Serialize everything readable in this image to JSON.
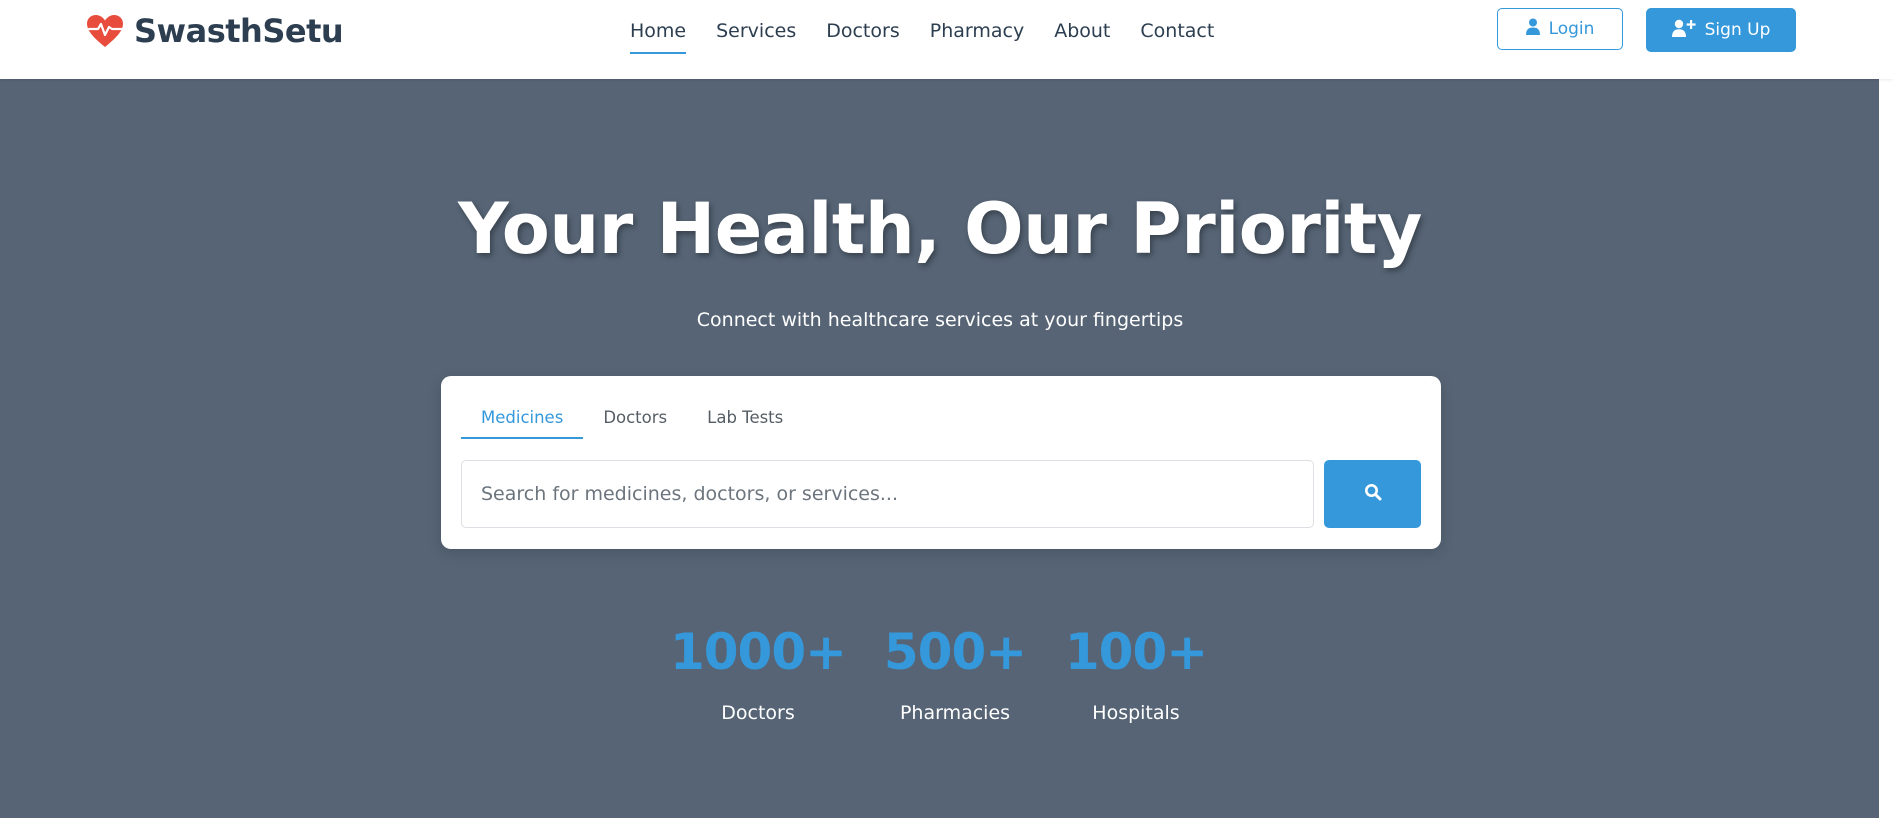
{
  "brand": {
    "name": "SwasthSetu"
  },
  "nav": {
    "items": [
      {
        "label": "Home",
        "active": true
      },
      {
        "label": "Services",
        "active": false
      },
      {
        "label": "Doctors",
        "active": false
      },
      {
        "label": "Pharmacy",
        "active": false
      },
      {
        "label": "About",
        "active": false
      },
      {
        "label": "Contact",
        "active": false
      }
    ]
  },
  "auth": {
    "login_label": "Login",
    "signup_label": "Sign Up"
  },
  "hero": {
    "title": "Your Health, Our Priority",
    "subtitle": "Connect with healthcare services at your fingertips"
  },
  "search": {
    "tabs": [
      {
        "label": "Medicines",
        "active": true
      },
      {
        "label": "Doctors",
        "active": false
      },
      {
        "label": "Lab Tests",
        "active": false
      }
    ],
    "placeholder": "Search for medicines, doctors, or services...",
    "value": ""
  },
  "stats": [
    {
      "value": "1000+",
      "label": "Doctors"
    },
    {
      "value": "500+",
      "label": "Pharmacies"
    },
    {
      "value": "100+",
      "label": "Hospitals"
    }
  ],
  "colors": {
    "accent": "#3498db",
    "brand_heart": "#e74c3c",
    "hero_bg": "#566475",
    "text_dark": "#2c3e50"
  },
  "icons": {
    "brand": "heartbeat-icon",
    "login": "user-icon",
    "signup": "user-plus-icon",
    "search": "search-icon"
  }
}
